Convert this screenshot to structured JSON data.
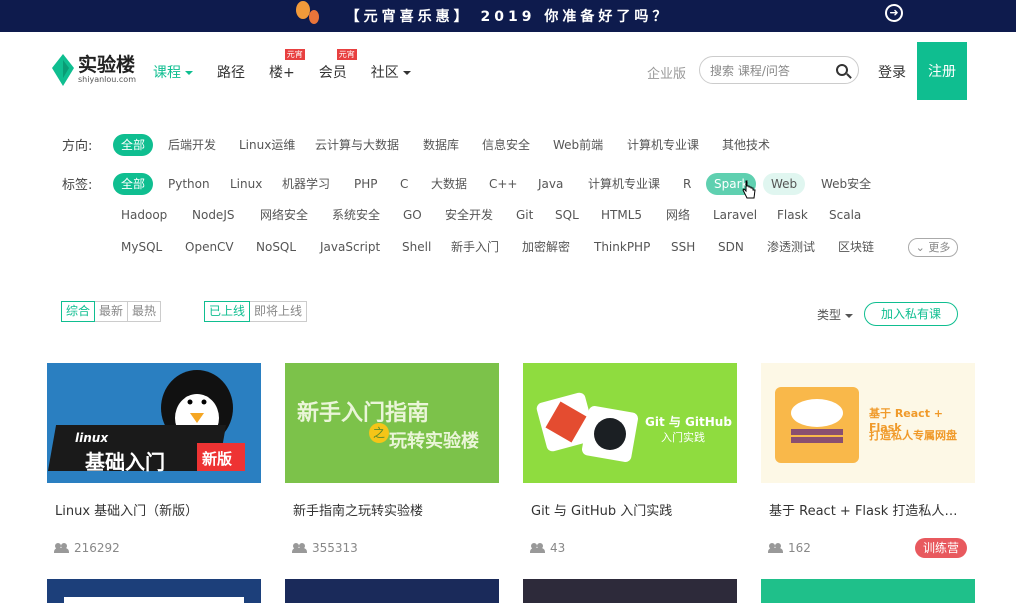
{
  "promo": {
    "text": "【元宵喜乐惠】 2019 你准备好了吗？"
  },
  "brand": {
    "name": "实验楼",
    "domain": "shiyanlou.com",
    "color": "#0fbe90"
  },
  "nav": [
    {
      "label": "课程",
      "active": true,
      "caret": true
    },
    {
      "label": "路径"
    },
    {
      "label": "楼+",
      "badge": "元宵"
    },
    {
      "label": "会员",
      "badge": "元宵"
    },
    {
      "label": "社区",
      "caret": true
    }
  ],
  "header": {
    "enterprise": "企业版",
    "search_placeholder": "搜索 课程/问答",
    "login": "登录",
    "register": "注册"
  },
  "filters": {
    "direction_label": "方向:",
    "directions": [
      "全部",
      "后端开发",
      "Linux运维",
      "云计算与大数据",
      "数据库",
      "信息安全",
      "Web前端",
      "计算机专业课",
      "其他技术"
    ],
    "tags_label": "标签:",
    "tags_row1": [
      "全部",
      "Python",
      "Linux",
      "机器学习",
      "PHP",
      "C",
      "大数据",
      "C++",
      "Java",
      "计算机专业课",
      "R",
      "Spark",
      "Web",
      "Web安全"
    ],
    "tags_row2": [
      "Hadoop",
      "NodeJS",
      "网络安全",
      "系统安全",
      "GO",
      "安全开发",
      "Git",
      "SQL",
      "HTML5",
      "网络",
      "Laravel",
      "Flask",
      "Scala"
    ],
    "tags_row3": [
      "MySQL",
      "OpenCV",
      "NoSQL",
      "JavaScript",
      "Shell",
      "新手入门",
      "加密解密",
      "ThinkPHP",
      "SSH",
      "SDN",
      "渗透测试",
      "区块链"
    ],
    "more": "更多"
  },
  "sort": {
    "options": [
      "综合",
      "最新",
      "最热"
    ],
    "status": [
      "已上线",
      "即将上线"
    ],
    "type_label": "类型",
    "private_button": "加入私有课"
  },
  "courses": [
    {
      "title": "Linux 基础入门（新版）",
      "users": "216292",
      "thumb_text_1": "linux",
      "thumb_text_2": "基础入门",
      "thumb_text_3": "新版"
    },
    {
      "title": "新手指南之玩转实验楼",
      "users": "355313",
      "thumb_text_1": "新手入门指南",
      "thumb_text_2": "之",
      "thumb_text_3": "玩转实验楼"
    },
    {
      "title": "Git 与 GitHub 入门实践",
      "users": "43",
      "thumb_text_1": "Git 与 GitHub",
      "thumb_text_2": "入门实践"
    },
    {
      "title": "基于 React + Flask 打造私人专属网盘",
      "users": "162",
      "badge": "训练营",
      "thumb_text_1": "基于 React + Flask",
      "thumb_text_2": "打造私人专属网盘"
    }
  ]
}
